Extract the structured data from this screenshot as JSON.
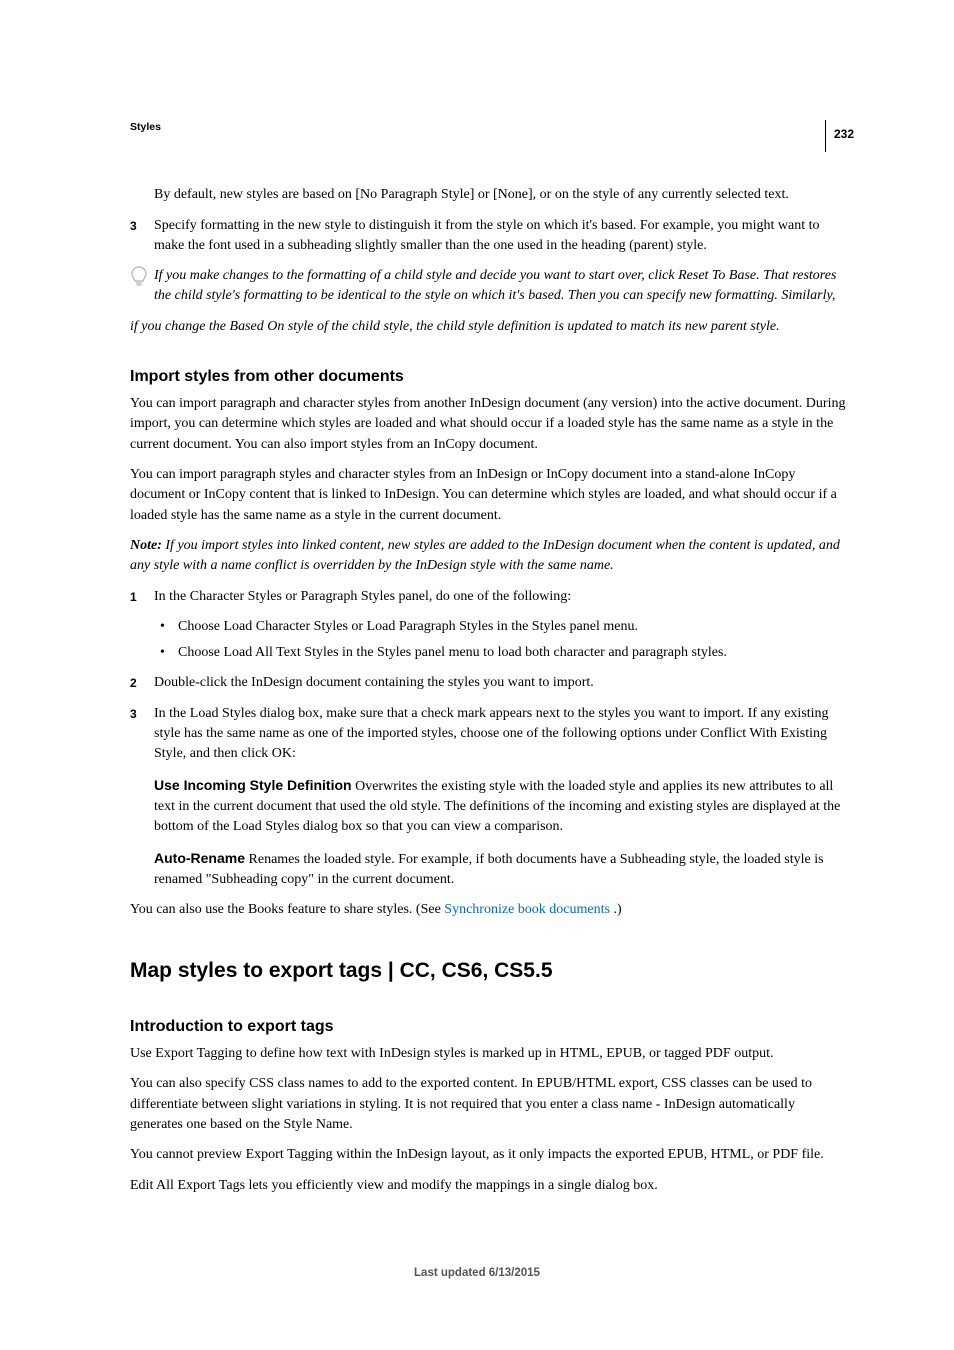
{
  "page_number": "232",
  "breadcrumb": "Styles",
  "intro_text": "By default, new styles are based on [No Paragraph Style] or [None], or on the style of any currently selected text.",
  "step3_text": "Specify formatting in the new style to distinguish it from the style on which it's based. For example, you might want to make the font used in a subheading slightly smaller than the one used in the heading (parent) style.",
  "tip_line1": "If you make changes to the formatting of a child style and decide you want to start over, click Reset To Base. That restores the child style's formatting to be identical to the style on which it's based. Then you can specify new formatting. Similarly,",
  "tip_line2": "if you change the Based On style of the child style, the child style definition is updated to match its new parent style.",
  "import": {
    "heading": "Import styles from other documents",
    "p1": "You can import paragraph and character styles from another InDesign document (any version) into the active document. During import, you can determine which styles are loaded and what should occur if a loaded style has the same name as a style in the current document. You can also import styles from an InCopy document.",
    "p2": "You can import paragraph styles and character styles from an InDesign or InCopy document into a stand-alone InCopy document or InCopy content that is linked to InDesign. You can determine which styles are loaded, and what should occur if a loaded style has the same name as a style in the current document.",
    "note_label": "Note:",
    "note_body": " If you import styles into linked content, new styles are added to the InDesign document when the content is updated, and any style with a name conflict is overridden by the InDesign style with the same name.",
    "step1": "In the Character Styles or Paragraph Styles panel, do one of the following:",
    "bullet1": "Choose Load Character Styles or Load Paragraph Styles in the Styles panel menu.",
    "bullet2": "Choose Load All Text Styles in the Styles panel menu to load both character and paragraph styles.",
    "step2": "Double-click the InDesign document containing the styles you want to import.",
    "step3": "In the Load Styles dialog box, make sure that a check mark appears next to the styles you want to import. If any existing style has the same name as one of the imported styles, choose one of the following options under Conflict With Existing Style, and then click OK:",
    "use_incoming_label": "Use Incoming Style Definition",
    "use_incoming_body": "  Overwrites the existing style with the loaded style and applies its new attributes to all text in the current document that used the old style. The definitions of the incoming and existing styles are displayed at the bottom of the Load Styles dialog box so that you can view a comparison.",
    "auto_rename_label": "Auto-Rename",
    "auto_rename_body": "  Renames the loaded style. For example, if both documents have a Subheading style, the loaded style is renamed \"Subheading copy\" in the current document.",
    "books_prefix": "You can also use the Books feature to share styles. (See ",
    "books_link": "Synchronize book documents",
    "books_suffix": " .)"
  },
  "map": {
    "heading": "Map styles to export tags | CC, CS6, CS5.5",
    "sub_heading": "Introduction to export tags",
    "p1": "Use Export Tagging to define how text with InDesign styles is marked up in HTML, EPUB, or tagged PDF output.",
    "p2": "You can also specify CSS class names to add to the exported content. In EPUB/HTML export, CSS classes can be used to differentiate between slight variations in styling. It is not required that you enter a class name - InDesign automatically generates one based on the Style Name.",
    "p3": "You cannot preview Export Tagging within the InDesign layout, as it only impacts the exported EPUB, HTML, or PDF file.",
    "p4": "Edit All Export Tags lets you efficiently view and modify the mappings in a single dialog box."
  },
  "footer": "Last updated 6/13/2015"
}
